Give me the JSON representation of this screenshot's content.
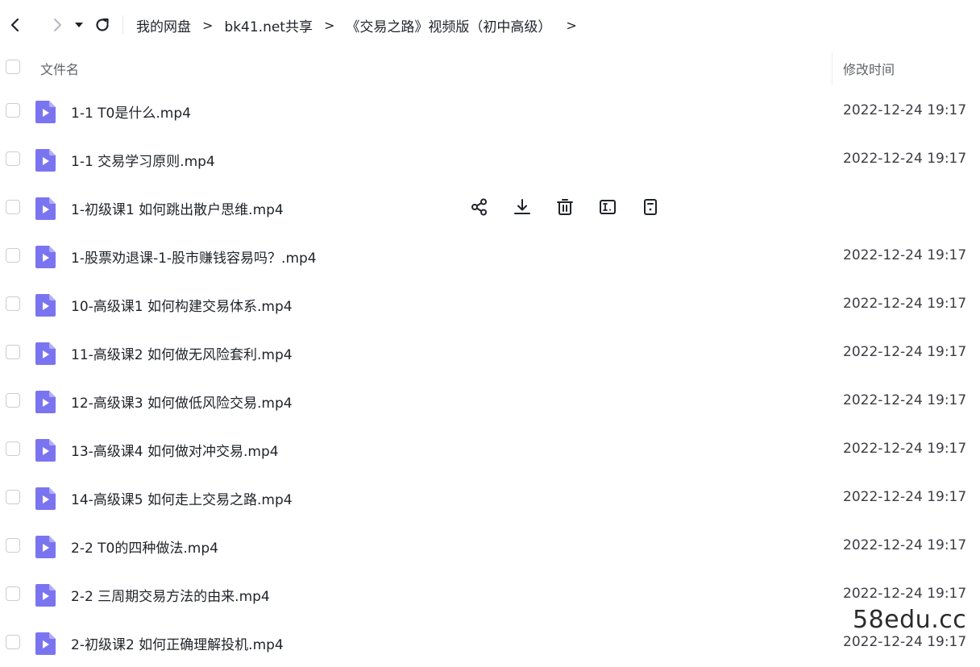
{
  "toolbar": {
    "back_icon": "chevron-left-icon",
    "forward_icon": "chevron-right-icon",
    "history_icon": "caret-down-icon",
    "refresh_icon": "refresh-icon"
  },
  "breadcrumb": [
    {
      "label": "我的网盘"
    },
    {
      "label": "bk41.net共享"
    },
    {
      "label": "《交易之路》视频版（初中高级）"
    }
  ],
  "breadcrumb_sep": ">",
  "table": {
    "col_name": "文件名",
    "col_time": "修改时间"
  },
  "files": [
    {
      "name": "1-1 T0是什么.mp4",
      "time": "2022-12-24 19:17"
    },
    {
      "name": "1-1 交易学习原则.mp4",
      "time": "2022-12-24 19:17"
    },
    {
      "name": "1-初级课1 如何跳出散户思维.mp4",
      "time": ""
    },
    {
      "name": "1-股票劝退课-1-股市赚钱容易吗？.mp4",
      "time": "2022-12-24 19:17"
    },
    {
      "name": "10-高级课1  如何构建交易体系.mp4",
      "time": "2022-12-24 19:17"
    },
    {
      "name": "11-高级课2  如何做无风险套利.mp4",
      "time": "2022-12-24 19:17"
    },
    {
      "name": "12-高级课3  如何做低风险交易.mp4",
      "time": "2022-12-24 19:17"
    },
    {
      "name": "13-高级课4  如何做对冲交易.mp4",
      "time": "2022-12-24 19:17"
    },
    {
      "name": "14-高级课5  如何走上交易之路.mp4",
      "time": "2022-12-24 19:17"
    },
    {
      "name": "2-2 T0的四种做法.mp4",
      "time": "2022-12-24 19:17"
    },
    {
      "name": "2-2 三周期交易方法的由来.mp4",
      "time": "2022-12-24 19:17"
    },
    {
      "name": "2-初级课2 如何正确理解投机.mp4",
      "time": "2022-12-24 19:17"
    }
  ],
  "hover_actions": [
    {
      "icon": "share-icon"
    },
    {
      "icon": "download-icon"
    },
    {
      "icon": "trash-icon"
    },
    {
      "icon": "rename-icon"
    },
    {
      "icon": "more-icon"
    }
  ],
  "watermark": "58edu.cc",
  "colors": {
    "file_icon": "#7b74f0",
    "file_icon_fold": "#b3aef8"
  }
}
